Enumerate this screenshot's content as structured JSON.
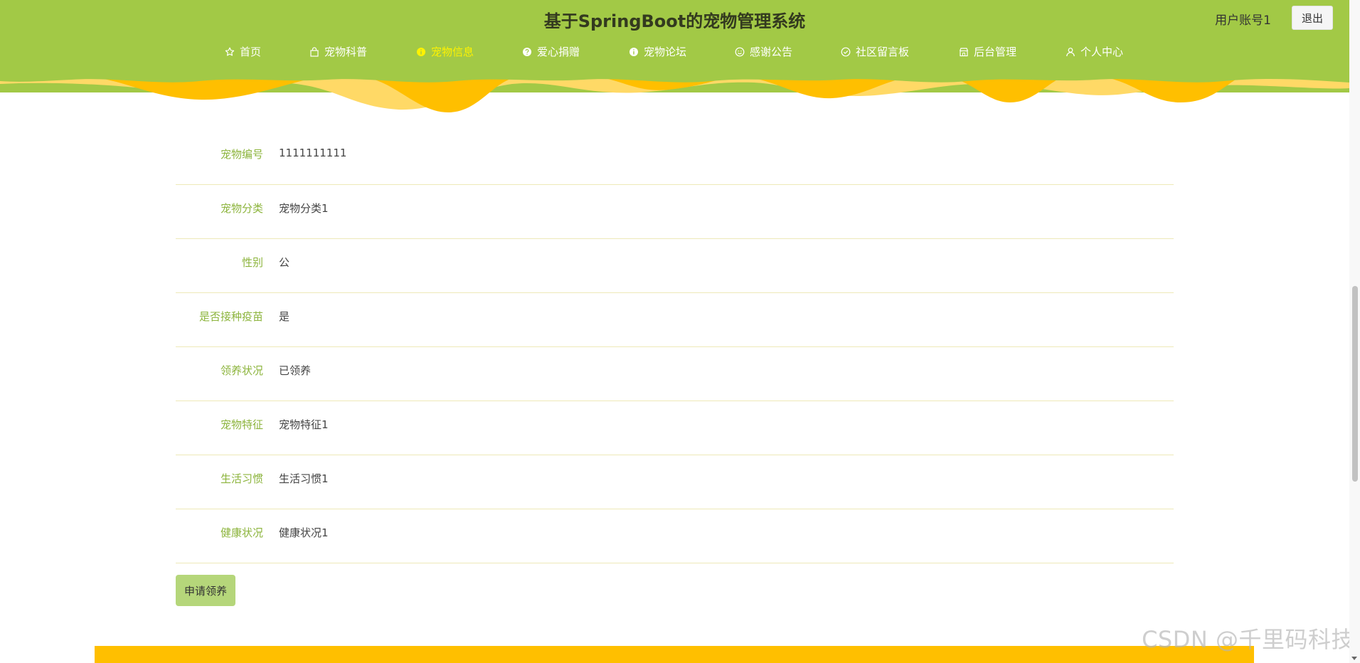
{
  "header": {
    "title": "基于SpringBoot的宠物管理系统",
    "account": "用户账号1",
    "logout_label": "退出"
  },
  "nav": {
    "items": [
      {
        "label": "首页",
        "icon": "star-icon"
      },
      {
        "label": "宠物科普",
        "icon": "bag-icon"
      },
      {
        "label": "宠物信息",
        "icon": "info-circle-icon",
        "active": true
      },
      {
        "label": "爱心捐赠",
        "icon": "question-circle-icon"
      },
      {
        "label": "宠物论坛",
        "icon": "info-circle-icon"
      },
      {
        "label": "感谢公告",
        "icon": "smile-icon"
      },
      {
        "label": "社区留言板",
        "icon": "check-circle-icon"
      },
      {
        "label": "后台管理",
        "icon": "shop-icon"
      },
      {
        "label": "个人中心",
        "icon": "user-icon"
      }
    ]
  },
  "detail": {
    "fields": [
      {
        "label": "宠物编号",
        "value": "1111111111"
      },
      {
        "label": "宠物分类",
        "value": "宠物分类1"
      },
      {
        "label": "性别",
        "value": "公"
      },
      {
        "label": "是否接种疫苗",
        "value": "是"
      },
      {
        "label": "领养状况",
        "value": "已领养"
      },
      {
        "label": "宠物特征",
        "value": "宠物特征1"
      },
      {
        "label": "生活习惯",
        "value": "生活习惯1"
      },
      {
        "label": "健康状况",
        "value": "健康状况1"
      }
    ],
    "apply_label": "申请领养"
  },
  "watermark": "CSDN @千里码科技",
  "colors": {
    "header_bg": "#a2c946",
    "wave_yellow": "#ffbf00",
    "wave_light": "#ffd966",
    "active_nav": "#fff200",
    "label_green": "#8cb43c",
    "button_bg": "#b5d67a"
  }
}
